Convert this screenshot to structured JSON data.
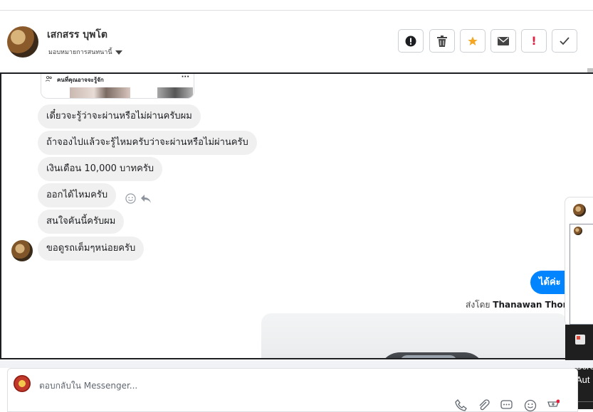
{
  "header": {
    "contact_name": "เสกสรร บุพโต",
    "assign_label": "มอบหมายการสนทนานี้",
    "actions": [
      {
        "name": "report-icon",
        "label": "!"
      },
      {
        "name": "trash-icon"
      },
      {
        "name": "star-icon",
        "color": "#f5a623"
      },
      {
        "name": "envelope-icon"
      },
      {
        "name": "exclamation-icon",
        "label": "!",
        "color": "#e41e3f"
      },
      {
        "name": "checkmark-icon"
      }
    ]
  },
  "shared_card": {
    "title": "คนที่คุณอาจจะรู้จัก",
    "more": "···"
  },
  "messages": [
    "เดี๋ยวจะรู้ว่าจะผ่านหรือไม่ผ่านครับผม",
    "ถ้าจองไปแล้วจะรู้ไหมครับว่าจะผ่านหรือไม่ผ่านครับ",
    "เงินเดือน 10,000 บาทครับ",
    "ออกได้ไหมครับ",
    "สนใจคันนี้ครับผม",
    "ขอดูรถเต็มๆหน่อยครับ"
  ],
  "sent_message": "ได้ค่ะ",
  "sent_by": {
    "prefix": "ส่งโดย",
    "name": "Thanawan Thon"
  },
  "composer": {
    "placeholder": "ตอบกลับใน Messenger..."
  },
  "side_popup": {
    "line1": "Scre",
    "line2": "Aut"
  },
  "colors": {
    "accent": "#0084ff",
    "bubble": "#f0f0f0"
  }
}
